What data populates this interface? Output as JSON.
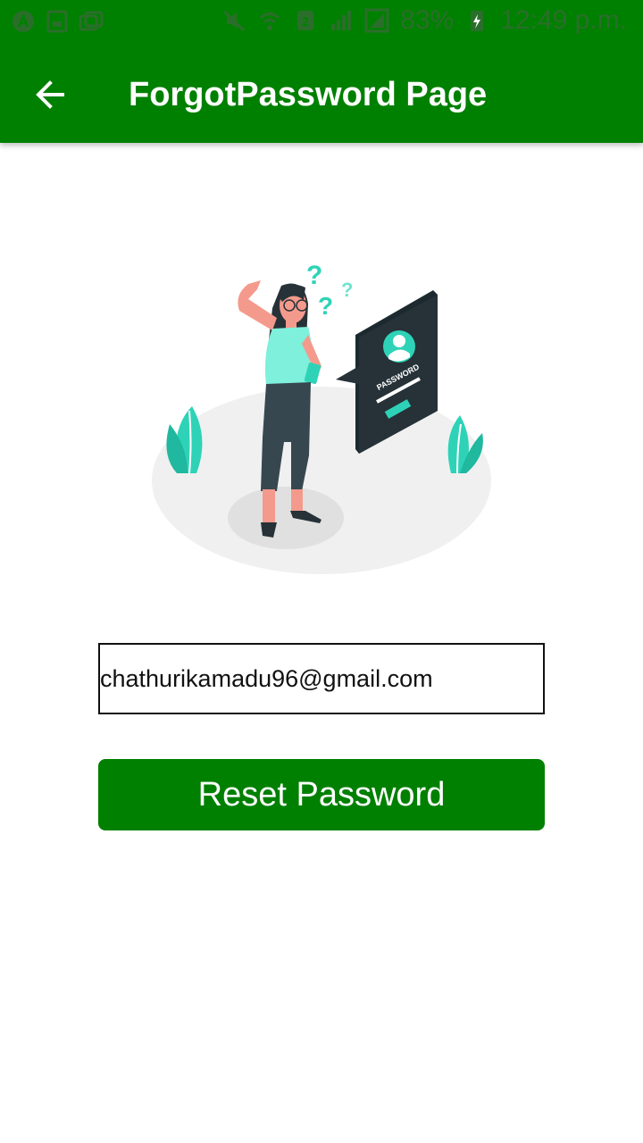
{
  "status_bar": {
    "battery": "83%",
    "time": "12:49 p.m."
  },
  "app_bar": {
    "title": "ForgotPassword Page",
    "back_icon": "arrow-back-icon"
  },
  "illustration": {
    "password_card_label": "PASSWORD",
    "question_marks": [
      "?",
      "?",
      "?"
    ]
  },
  "form": {
    "email_value": "chathurikamadu96@gmail.com",
    "reset_label": "Reset Password"
  },
  "colors": {
    "primary": "#008000",
    "accent": "#2ed3b7",
    "dark": "#263238"
  }
}
